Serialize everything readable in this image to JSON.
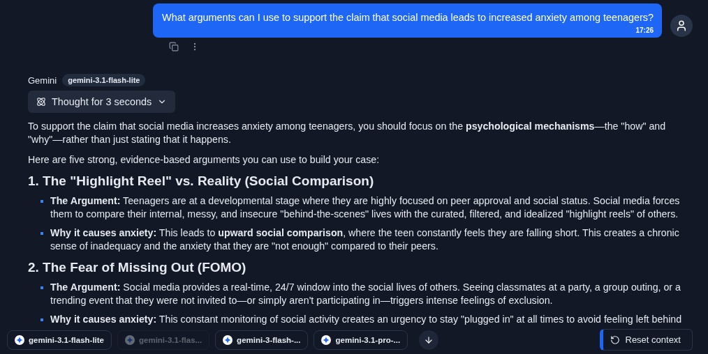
{
  "user_message": {
    "text": "What arguments can I use to support the claim that social media leads to increased anxiety among teenagers?",
    "time": "17:26"
  },
  "assistant": {
    "name": "Gemini",
    "model": "gemini-3.1-flash-lite",
    "thought": {
      "label": "Thought for 3 seconds",
      "expanded": false
    }
  },
  "content": [
    {
      "kind": "paragraph",
      "text": "To support the claim that social media increases anxiety among teenagers, you should focus on the **psychological mechanisms**—the \"how\" and \"why\"—rather than just stating that it happens."
    },
    {
      "kind": "paragraph",
      "text": "Here are five strong, evidence-based arguments you can use to build your case:"
    },
    {
      "kind": "heading",
      "text": "1. The \"Highlight Reel\" vs. Reality (Social Comparison)"
    },
    {
      "kind": "bullets",
      "items": [
        "**The Argument:** Teenagers are at a developmental stage where they are highly focused on peer approval and social status. Social media forces them to compare their internal, messy, and insecure \"behind-the-scenes\" lives with the curated, filtered, and idealized \"highlight reels\" of others.",
        "**Why it causes anxiety:** This leads to **upward social comparison**, where the teen constantly feels they are falling short. This creates a chronic sense of inadequacy and the anxiety that they are \"not enough\" compared to their peers."
      ]
    },
    {
      "kind": "heading",
      "text": "2. The Fear of Missing Out (FOMO)"
    },
    {
      "kind": "bullets",
      "items": [
        "**The Argument:** Social media provides a real-time, 24/7 window into the social lives of others. Seeing classmates at a party, a group outing, or a trending event that they were not invited to—or simply aren't participating in—triggers intense feelings of exclusion.",
        "**Why it causes anxiety:** This constant monitoring of social activity creates an urgency to stay \"plugged in\" at all times to avoid feeling left behind"
      ]
    }
  ],
  "model_chips": [
    {
      "label": "gemini-3.1-flash-lite",
      "disabled": false
    },
    {
      "label": "gemini-3.1-flas...",
      "disabled": true
    },
    {
      "label": "gemini-3-flash-...",
      "disabled": false
    },
    {
      "label": "gemini-3.1-pro-...",
      "disabled": false
    }
  ],
  "reset_button": {
    "label": "Reset context"
  }
}
